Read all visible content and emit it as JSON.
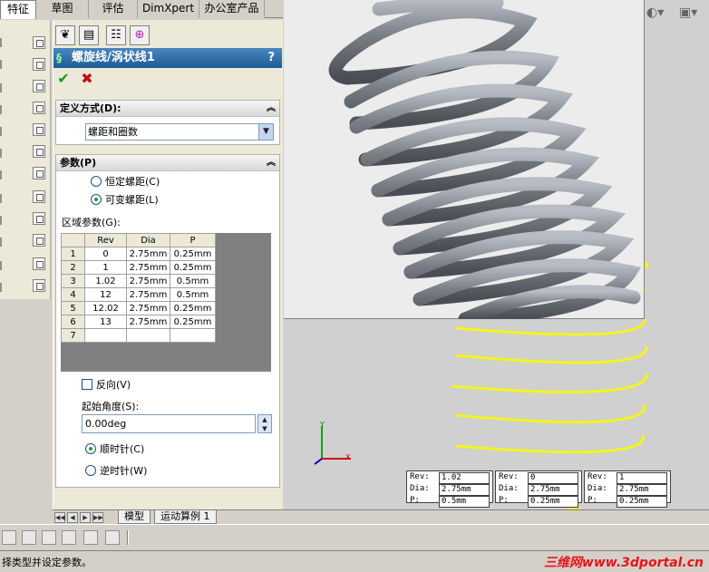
{
  "tabs": [
    {
      "label": "特征",
      "active": true
    },
    {
      "label": "草图",
      "active": false
    },
    {
      "label": "评估",
      "active": false
    },
    {
      "label": "DimXpert",
      "active": false
    },
    {
      "label": "办公室产品",
      "active": false
    }
  ],
  "property_manager": {
    "icons": [
      "feature-manager-icon",
      "property-manager-icon",
      "configuration-manager-icon",
      "dimxpert-manager-icon"
    ],
    "title": "螺旋线/涡状线1",
    "help": "?",
    "ok": "✔",
    "cancel": "✖",
    "definition": {
      "header": "定义方式(D):",
      "value": "螺距和圈数"
    },
    "parameters": {
      "header": "参数(P)",
      "constant_pitch": "恒定螺距(C)",
      "variable_pitch": "可变螺距(L)",
      "region_label": "区域参数(G):",
      "columns": [
        "Rev",
        "Dia",
        "P"
      ],
      "rows": [
        {
          "n": "1",
          "rev": "0",
          "dia": "2.75mm",
          "p": "0.25mm"
        },
        {
          "n": "2",
          "rev": "1",
          "dia": "2.75mm",
          "p": "0.25mm"
        },
        {
          "n": "3",
          "rev": "1.02",
          "dia": "2.75mm",
          "p": "0.5mm"
        },
        {
          "n": "4",
          "rev": "12",
          "dia": "2.75mm",
          "p": "0.5mm"
        },
        {
          "n": "5",
          "rev": "12.02",
          "dia": "2.75mm",
          "p": "0.25mm"
        },
        {
          "n": "6",
          "rev": "13",
          "dia": "2.75mm",
          "p": "0.25mm"
        },
        {
          "n": "7",
          "rev": "",
          "dia": "",
          "p": ""
        }
      ],
      "reverse": "反向(V)",
      "start_angle_label": "起始角度(S):",
      "start_angle_value": "0.00deg",
      "clockwise": "顺时针(C)",
      "counterclockwise": "逆时针(W)"
    }
  },
  "viewport": {
    "readouts": [
      {
        "rev": "1.02",
        "dia": "2.75mm",
        "p": "0.5mm"
      },
      {
        "rev": "0",
        "dia": "2.75mm",
        "p": "0.25mm"
      },
      {
        "rev": "1",
        "dia": "2.75mm",
        "p": "0.25mm"
      }
    ],
    "readout_keys": {
      "rev": "Rev:",
      "dia": "Dia:",
      "p": "P:"
    },
    "triad": {
      "x": "X",
      "y": "Y"
    },
    "spring_color": "#7d8189",
    "preview_color": "#f4f41e"
  },
  "bottom_tabs": [
    "模型",
    "运动算例 1"
  ],
  "status_text": "择类型并设定参数。",
  "watermark": "三维网www.3dportal.cn"
}
